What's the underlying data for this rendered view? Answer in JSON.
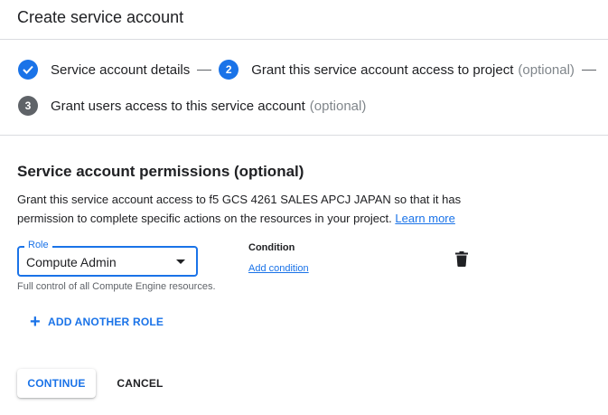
{
  "header": {
    "title": "Create service account"
  },
  "steps": [
    {
      "number": "",
      "label": "Service account details",
      "optional": "",
      "state": "completed",
      "color": "#1a73e8"
    },
    {
      "number": "2",
      "label": "Grant this service account access to project",
      "optional": "(optional)",
      "state": "active",
      "color": "#1a73e8"
    },
    {
      "number": "3",
      "label": "Grant users access to this service account",
      "optional": "(optional)",
      "state": "pending",
      "color": "#5f6368"
    }
  ],
  "permissions": {
    "title": "Service account permissions (optional)",
    "description": "Grant this service account access to f5 GCS 4261 SALES APCJ JAPAN so that it has permission to complete specific actions on the resources in your project.",
    "learn_more": "Learn more"
  },
  "role": {
    "label": "Role",
    "value": "Compute Admin",
    "helper": "Full control of all Compute Engine resources."
  },
  "condition": {
    "title": "Condition",
    "add_link": "Add condition"
  },
  "add_another_role": {
    "icon": "plus-icon",
    "label": "ADD ANOTHER ROLE"
  },
  "actions": {
    "continue": "CONTINUE",
    "cancel": "CANCEL"
  },
  "colors": {
    "accent": "#1a73e8",
    "text": "#202124",
    "muted": "#5f6368",
    "divider": "#dadce0"
  }
}
